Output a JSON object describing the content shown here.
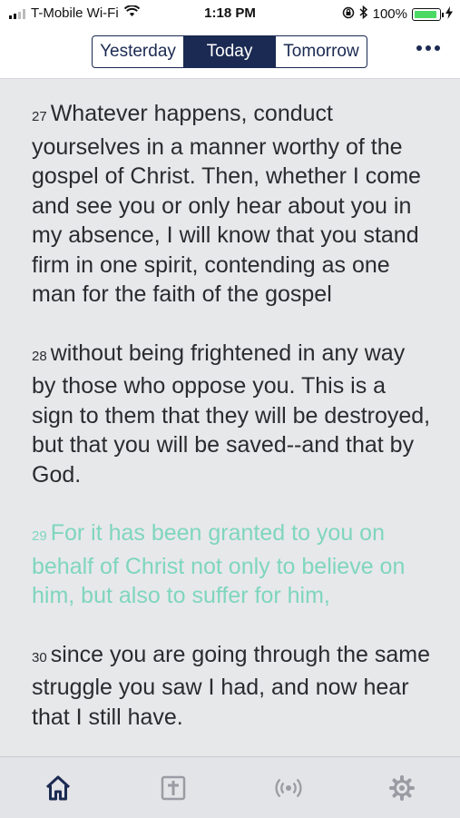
{
  "status_bar": {
    "carrier": "T-Mobile Wi-Fi",
    "time": "1:18 PM",
    "battery": "100%",
    "battery_level": 1.0
  },
  "header": {
    "tabs": [
      {
        "label": "Yesterday",
        "active": false
      },
      {
        "label": "Today",
        "active": true
      },
      {
        "label": "Tomorrow",
        "active": false
      }
    ],
    "more_icon": "more-horizontal-icon"
  },
  "verses": [
    {
      "number": "27",
      "text": "Whatever happens, conduct yourselves in a manner worthy of the gospel of Christ. Then, whether I come and see you or only hear about you in my absence, I will know that you stand firm in one spirit, contending as one man for the faith of the gospel",
      "highlighted": false
    },
    {
      "number": "28",
      "text": "without being frightened in any way by those who oppose you. This is a sign to them that they will be destroyed, but that you will be saved--and that by God.",
      "highlighted": false
    },
    {
      "number": "29",
      "text": "For it has been granted to you on behalf of Christ not only to believe on him, but also to suffer for him,",
      "highlighted": true
    },
    {
      "number": "30",
      "text": "since you are going through the same struggle you saw I had, and now hear that I still have.",
      "highlighted": false
    }
  ],
  "tab_bar": {
    "items": [
      {
        "icon": "home-icon",
        "active": true
      },
      {
        "icon": "bible-icon",
        "active": false
      },
      {
        "icon": "broadcast-icon",
        "active": false
      },
      {
        "icon": "gear-icon",
        "active": false
      }
    ]
  },
  "colors": {
    "accent": "#1b2a52",
    "highlight": "#7fd6bd",
    "background": "#e7e8ea",
    "battery": "#4cd964"
  }
}
